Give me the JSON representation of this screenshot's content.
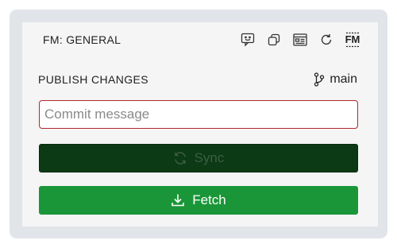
{
  "header": {
    "title": "FM: GENERAL",
    "icons": [
      "feedback-icon",
      "copy-icon",
      "dashboard-icon",
      "refresh-icon",
      "fm-logo-icon"
    ],
    "logo_text": "FM"
  },
  "publish": {
    "title": "PUBLISH CHANGES",
    "branch": "main"
  },
  "commit": {
    "placeholder": "Commit message",
    "value": ""
  },
  "actions": {
    "sync_label": "Sync",
    "fetch_label": "Fetch"
  },
  "colors": {
    "sync_bg": "#0b3a14",
    "fetch_bg": "#1a9638",
    "error_border": "#b3262d"
  }
}
